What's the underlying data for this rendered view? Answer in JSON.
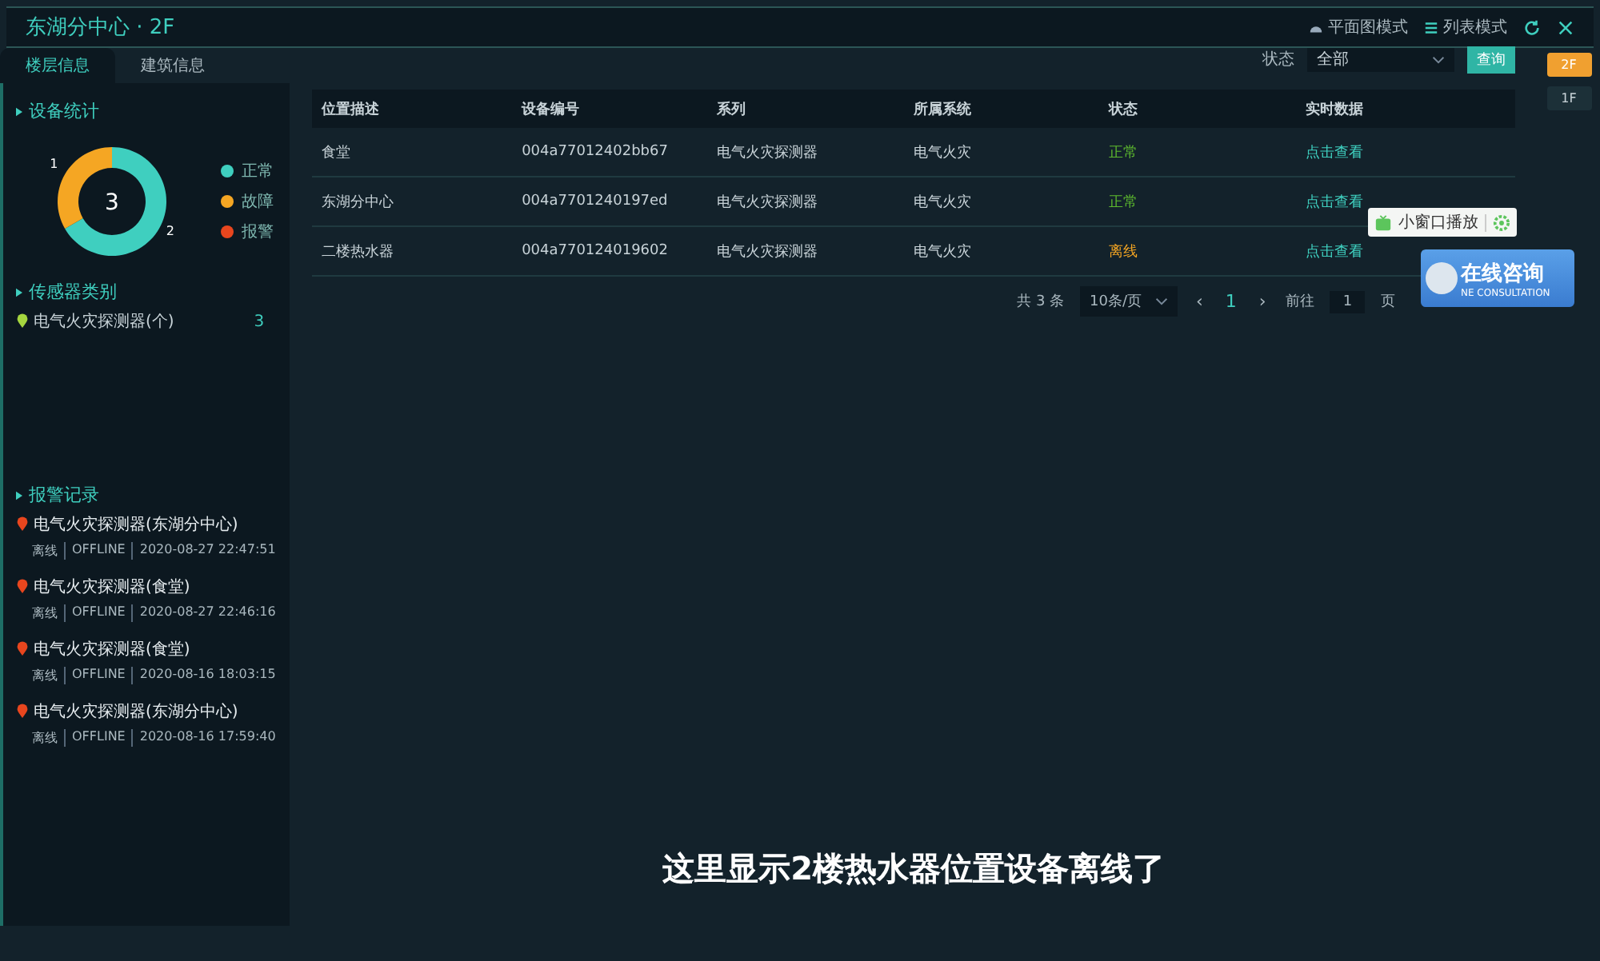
{
  "header": {
    "title": "东湖分中心 · 2F",
    "modes": [
      {
        "label": "平面图模式",
        "kind": "plan"
      },
      {
        "label": "列表模式",
        "kind": "list"
      }
    ]
  },
  "tabs": [
    {
      "label": "楼层信息",
      "selected": true
    },
    {
      "label": "建筑信息",
      "selected": false
    }
  ],
  "sidebar": {
    "device_stats": {
      "title": "设备统计",
      "total": "3",
      "legend": [
        {
          "color": "#3fcfbf"
        },
        {
          "color": "#f5a623"
        },
        {
          "color": "#e8461e"
        }
      ],
      "chart_data": {
        "type": "donut",
        "categories": [
          "正常",
          "故障",
          "报警"
        ],
        "values": [
          2,
          1,
          0
        ],
        "data_labels": true
      }
    },
    "sensor_types": {
      "title": "传感器类别",
      "items": [
        {
          "label": "电气火灾探测器(个)",
          "count": "3"
        }
      ]
    },
    "alarms": {
      "title": "报警记录",
      "items": [
        {
          "title": "电气火灾探测器(东湖分中心)",
          "status": "离线",
          "code": "OFFLINE",
          "time": "2020-08-27 22:47:51"
        },
        {
          "title": "电气火灾探测器(食堂)",
          "status": "离线",
          "code": "OFFLINE",
          "time": "2020-08-27 22:46:16"
        },
        {
          "title": "电气火灾探测器(食堂)",
          "status": "离线",
          "code": "OFFLINE",
          "time": "2020-08-16 18:03:15"
        },
        {
          "title": "电气火灾探测器(东湖分中心)",
          "status": "离线",
          "code": "OFFLINE",
          "time": "2020-08-16 17:59:40"
        }
      ]
    }
  },
  "filter": {
    "label": "状态",
    "value": "全部",
    "button": "查询"
  },
  "floors": [
    {
      "label": "2F",
      "selected": true
    },
    {
      "label": "1F",
      "selected": false
    }
  ],
  "table": {
    "columns": [
      "位置描述",
      "设备编号",
      "系列",
      "所属系统",
      "状态",
      "实时数据"
    ],
    "rows": [
      {
        "location": "食堂",
        "id": "004a77012402bb67",
        "series": "电气火灾探测器",
        "system": "电气火灾",
        "status": {
          "text": "正常",
          "color": "#5cb82e"
        },
        "link": "点击查看"
      },
      {
        "location": "东湖分中心",
        "id": "004a7701240197ed",
        "series": "电气火灾探测器",
        "system": "电气火灾",
        "status": {
          "text": "正常",
          "color": "#5cb82e"
        },
        "link": "点击查看"
      },
      {
        "location": "二楼热水器",
        "id": "004a770124019602",
        "series": "电气火灾探测器",
        "system": "电气火灾",
        "status": {
          "text": "离线",
          "color": "#f5a623"
        },
        "link": "点击查看"
      }
    ]
  },
  "pagination": {
    "total": "共 3 条",
    "page_size": "10条/页",
    "prev": "‹",
    "current": "1",
    "next": "›",
    "goto_label": "前往",
    "goto_value": "1",
    "goto_unit": "页"
  },
  "popup": {
    "label": "小窗口播放"
  },
  "chat_widget": {
    "title": "在线咨询",
    "subtitle": "NE CONSULTATION"
  },
  "subtitle": "这里显示2楼热水器位置设备离线了"
}
